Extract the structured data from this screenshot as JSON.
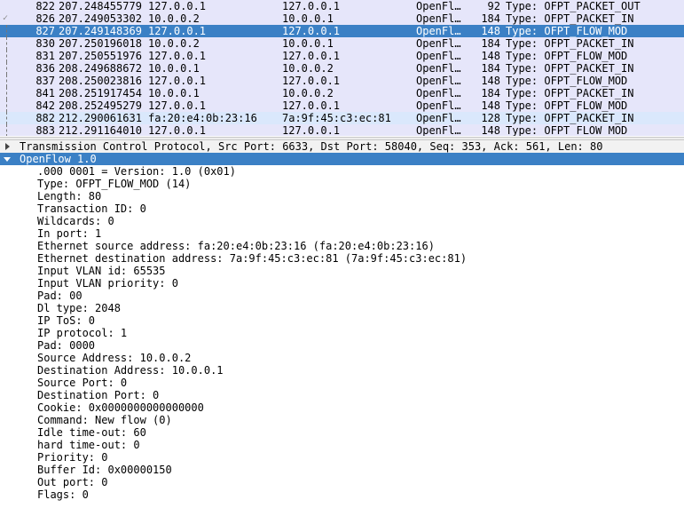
{
  "packet_list": [
    {
      "no": "822",
      "time": "207.248455779",
      "src": "127.0.0.1",
      "dst": "127.0.0.1",
      "proto": "OpenFl…",
      "len": "92",
      "info": "Type: OFPT_PACKET_OUT",
      "row": "lav",
      "related": ""
    },
    {
      "no": "826",
      "time": "207.249053302",
      "src": "10.0.0.2",
      "dst": "10.0.0.1",
      "proto": "OpenFl…",
      "len": "184",
      "info": "Type: OFPT_PACKET_IN",
      "row": "lav",
      "related": "mark"
    },
    {
      "no": "827",
      "time": "207.249148369",
      "src": "127.0.0.1",
      "dst": "127.0.0.1",
      "proto": "OpenFl…",
      "len": "148",
      "info": "Type: OFPT_FLOW_MOD",
      "row": "sel",
      "related": "line"
    },
    {
      "no": "830",
      "time": "207.250196018",
      "src": "10.0.0.2",
      "dst": "10.0.0.1",
      "proto": "OpenFl…",
      "len": "184",
      "info": "Type: OFPT_PACKET_IN",
      "row": "lav",
      "related": "line"
    },
    {
      "no": "831",
      "time": "207.250551976",
      "src": "127.0.0.1",
      "dst": "127.0.0.1",
      "proto": "OpenFl…",
      "len": "148",
      "info": "Type: OFPT_FLOW_MOD",
      "row": "lav",
      "related": "line"
    },
    {
      "no": "836",
      "time": "208.249688672",
      "src": "10.0.0.1",
      "dst": "10.0.0.2",
      "proto": "OpenFl…",
      "len": "184",
      "info": "Type: OFPT_PACKET_IN",
      "row": "lav",
      "related": "line"
    },
    {
      "no": "837",
      "time": "208.250023816",
      "src": "127.0.0.1",
      "dst": "127.0.0.1",
      "proto": "OpenFl…",
      "len": "148",
      "info": "Type: OFPT_FLOW_MOD",
      "row": "lav",
      "related": "line"
    },
    {
      "no": "841",
      "time": "208.251917454",
      "src": "10.0.0.1",
      "dst": "10.0.0.2",
      "proto": "OpenFl…",
      "len": "184",
      "info": "Type: OFPT_PACKET_IN",
      "row": "lav",
      "related": "line"
    },
    {
      "no": "842",
      "time": "208.252495279",
      "src": "127.0.0.1",
      "dst": "127.0.0.1",
      "proto": "OpenFl…",
      "len": "148",
      "info": "Type: OFPT_FLOW_MOD",
      "row": "lav",
      "related": "line"
    },
    {
      "no": "882",
      "time": "212.290061631",
      "src": "fa:20:e4:0b:23:16",
      "dst": "7a:9f:45:c3:ec:81",
      "proto": "OpenFl…",
      "len": "128",
      "info": "Type: OFPT_PACKET_IN",
      "row": "blu",
      "related": "line"
    },
    {
      "no": "883",
      "time": "212.291164010",
      "src": "127.0.0.1",
      "dst": "127.0.0.1",
      "proto": "OpenFl…",
      "len": "148",
      "info": "Type: OFPT_FLOW_MOD",
      "row": "lav",
      "related": "line"
    }
  ],
  "details": {
    "tcp_header": "Transmission Control Protocol, Src Port: 6633, Dst Port: 58040, Seq: 353, Ack: 561, Len: 80",
    "openflow_header": "OpenFlow 1.0",
    "fields": [
      ".000 0001 = Version: 1.0 (0x01)",
      "Type: OFPT_FLOW_MOD (14)",
      "Length: 80",
      "Transaction ID: 0",
      "Wildcards: 0",
      "In port: 1",
      "Ethernet source address: fa:20:e4:0b:23:16 (fa:20:e4:0b:23:16)",
      "Ethernet destination address: 7a:9f:45:c3:ec:81 (7a:9f:45:c3:ec:81)",
      "Input VLAN id: 65535",
      "Input VLAN priority: 0",
      "Pad: 00",
      "Dl type: 2048",
      "IP ToS: 0",
      "IP protocol: 1",
      "Pad: 0000",
      "Source Address: 10.0.0.2",
      "Destination Address: 10.0.0.1",
      "Source Port: 0",
      "Destination Port: 0",
      "Cookie: 0x0000000000000000",
      "Command: New flow (0)",
      "Idle time-out: 60",
      "hard time-out: 0",
      "Priority: 0",
      "Buffer Id: 0x00000150",
      "Out port: 0",
      "Flags: 0"
    ]
  },
  "colors": {
    "row_lavender": "#e6e6fa",
    "row_blue": "#dae8fc",
    "selection": "#3b80c5"
  },
  "icons": {
    "collapsed": "expand-arrow-right-icon",
    "expanded": "collapse-arrow-down-icon",
    "related_packet": "related-packet-check-icon"
  }
}
